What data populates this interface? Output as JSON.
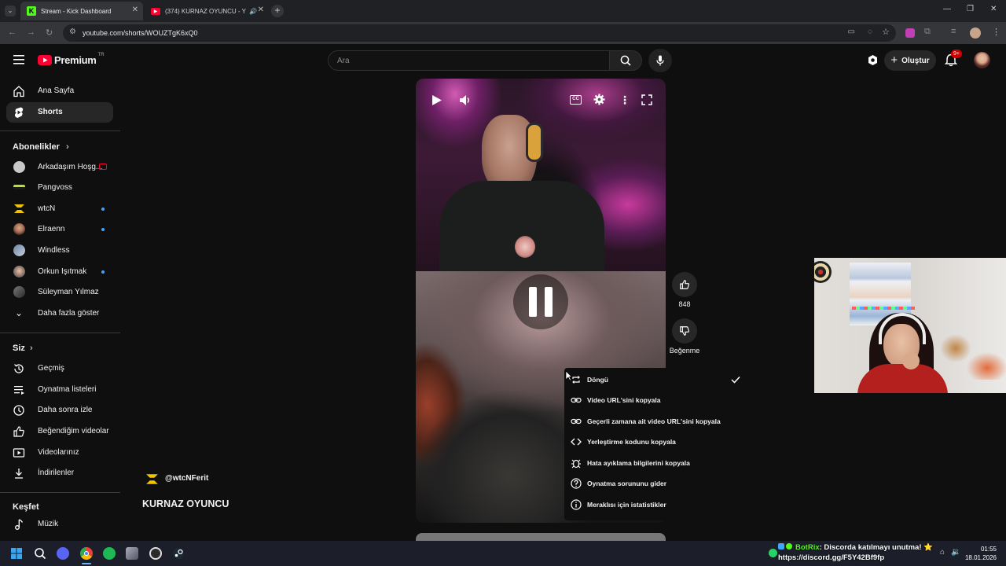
{
  "browser": {
    "tabs": [
      {
        "title": "Stream - Kick Dashboard",
        "active": true
      },
      {
        "title": "(374) KURNAZ OYUNCU - Y",
        "active": false
      }
    ],
    "url": "youtube.com/shorts/WOUZTgK6xQ0"
  },
  "header": {
    "logo": "Premium",
    "region": "TR",
    "search_placeholder": "Ara",
    "create_label": "Oluştur",
    "notif_badge": "9+"
  },
  "sidebar": {
    "home": "Ana Sayfa",
    "shorts": "Shorts",
    "subs_header": "Abonelikler",
    "subscriptions": [
      {
        "name": "Arkadaşım Hoşg...",
        "live": true,
        "dot": false
      },
      {
        "name": "Pangvoss",
        "live": false,
        "dot": false
      },
      {
        "name": "wtcN",
        "live": false,
        "dot": true
      },
      {
        "name": "Elraenn",
        "live": false,
        "dot": true
      },
      {
        "name": "Windless",
        "live": false,
        "dot": false
      },
      {
        "name": "Orkun Işıtmak",
        "live": false,
        "dot": true
      },
      {
        "name": "Süleyman Yılmaz",
        "live": false,
        "dot": false
      }
    ],
    "show_more": "Daha fazla göster",
    "you_header": "Siz",
    "you_items": [
      "Geçmiş",
      "Oynatma listeleri",
      "Daha sonra izle",
      "Beğendiğim videolar",
      "Videolarınız",
      "İndirilenler"
    ],
    "explore_header": "Keşfet",
    "explore_items": [
      "Müzik"
    ]
  },
  "video": {
    "channel": "@wtcNFerit",
    "title": "KURNAZ OYUNCU",
    "likes": "848",
    "dislike_label": "Beğenme"
  },
  "context_menu": [
    {
      "label": "Döngü",
      "icon": "loop-icon",
      "checked": true
    },
    {
      "label": "Video URL'sini kopyala",
      "icon": "link-icon",
      "checked": false
    },
    {
      "label": "Geçerli zamana ait video URL'sini kopyala",
      "icon": "link-icon",
      "checked": false
    },
    {
      "label": "Yerleştirme kodunu kopyala",
      "icon": "code-icon",
      "checked": false
    },
    {
      "label": "Hata ayıklama bilgilerini kopyala",
      "icon": "bug-icon",
      "checked": false
    },
    {
      "label": "Oynatma sorununu gider",
      "icon": "help-icon",
      "checked": false
    },
    {
      "label": "Meraklısı için istatistikler",
      "icon": "info-icon",
      "checked": false
    }
  ],
  "taskbar": {
    "chat_user": "BotRix",
    "chat_message": ": Discorda katılmayı unutma! ⭐",
    "chat_link": "https://discord.gg/F5Y42Bf9fp",
    "time": "01:55",
    "date": "18.01.2026"
  }
}
